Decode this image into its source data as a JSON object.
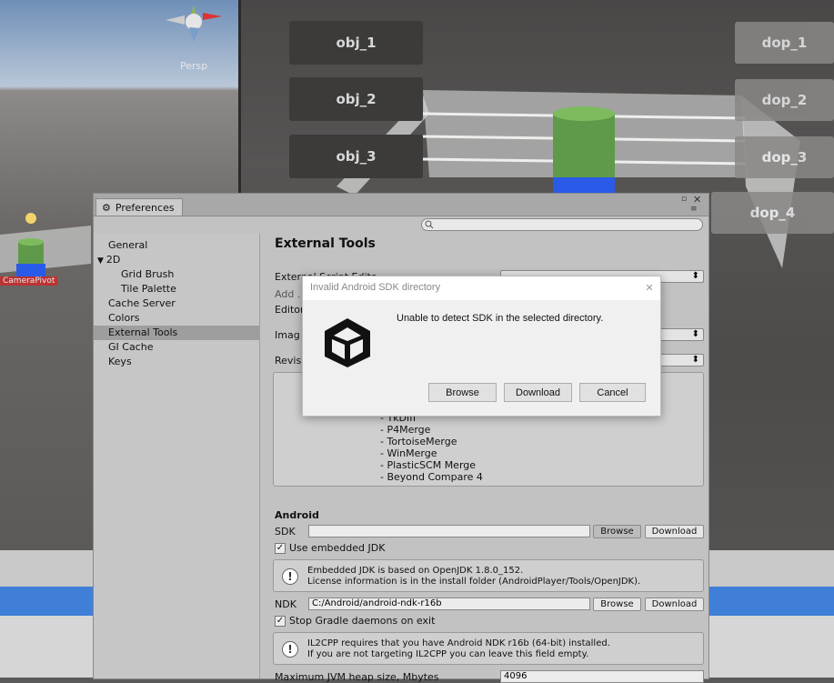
{
  "scene": {
    "persp_label": "Persp",
    "camera_pivot_label": "CameraPivot",
    "left_buttons": [
      "obj_1",
      "obj_2",
      "obj_3"
    ],
    "right_buttons": [
      "dop_1",
      "dop_2",
      "dop_3",
      "dop_4"
    ],
    "colors": {
      "cylinder_green": "#5f9a4a",
      "cylinder_blue": "#2a5ae8",
      "status_bar_blue": "#3f7fd8"
    }
  },
  "preferences": {
    "tab_label": "Preferences",
    "sidebar": [
      "General",
      "2D",
      "Grid Brush",
      "Tile Palette",
      "Cache Server",
      "Colors",
      "External Tools",
      "GI Cache",
      "Keys"
    ],
    "selected_item": "External Tools",
    "content": {
      "title": "External Tools",
      "external_script_editor_label": "External Script Edito",
      "external_script_editor_value": "",
      "add_args_label": "Add .",
      "editor_label": "Editor",
      "image_label": "Imag",
      "revision_label": "Revis",
      "diff_tools": [
        "- TkDiff",
        "- P4Merge",
        "- TortoiseMerge",
        "- WinMerge",
        "- PlasticSCM Merge",
        "- Beyond Compare 4"
      ],
      "android": {
        "title": "Android",
        "sdk_label": "SDK",
        "sdk_value": "",
        "browse_label": "Browse",
        "download_label": "Download",
        "use_embedded_jdk_label": "Use embedded JDK",
        "jdk_help_line1": "Embedded JDK is based on OpenJDK 1.8.0_152.",
        "jdk_help_line2": "License information is in the install folder (AndroidPlayer/Tools/OpenJDK).",
        "ndk_label": "NDK",
        "ndk_value": "C:/Android/android-ndk-r16b",
        "stop_gradle_label": "Stop Gradle daemons on exit",
        "il2cpp_help_line1": "IL2CPP requires that you have Android NDK r16b (64-bit) installed.",
        "il2cpp_help_line2": "If you are not targeting IL2CPP you can leave this field empty.",
        "jvm_heap_label": "Maximum JVM heap size, Mbytes",
        "jvm_heap_value": "4096"
      }
    }
  },
  "dialog": {
    "title": "Invalid Android SDK directory",
    "close_glyph": "✕",
    "message": "Unable to detect SDK in the selected directory.",
    "buttons": {
      "browse": "Browse",
      "download": "Download",
      "cancel": "Cancel"
    },
    "icon": "unity-logo-icon"
  }
}
